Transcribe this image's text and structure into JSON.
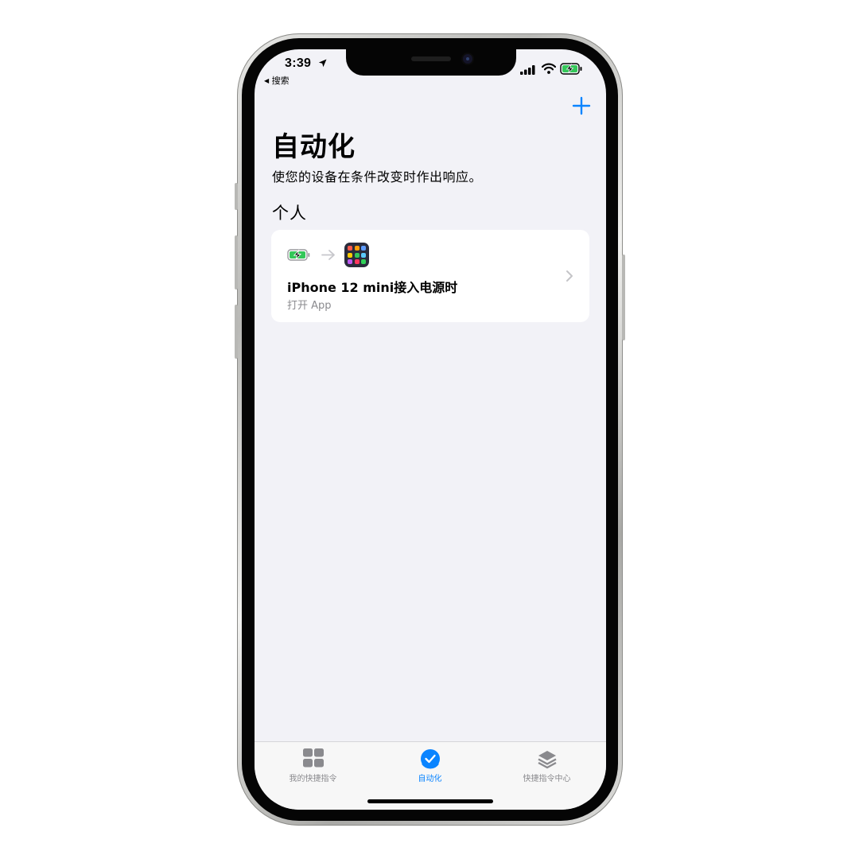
{
  "status_bar": {
    "time": "3:39",
    "back_label": "搜索"
  },
  "nav": {
    "add_symbol": "+"
  },
  "page": {
    "title": "自动化",
    "subtitle": "使您的设备在条件改变时作出响应。",
    "section_header": "个人"
  },
  "automation_card": {
    "trigger_icon": "battery-charging-icon",
    "action_icon": "shortcuts-app-icon",
    "title": "iPhone 12 mini接入电源时",
    "subtitle": "打开 App"
  },
  "tab_bar": {
    "tabs": [
      {
        "label": "我的快捷指令",
        "icon": "grid-icon",
        "active": false
      },
      {
        "label": "自动化",
        "icon": "automation-check-icon",
        "active": true
      },
      {
        "label": "快捷指令中心",
        "icon": "gallery-layers-icon",
        "active": false
      }
    ]
  },
  "colors": {
    "accent": "#0a84ff",
    "battery_green": "#34c759",
    "background": "#f2f2f7",
    "secondary_text": "#8a8a8e"
  }
}
